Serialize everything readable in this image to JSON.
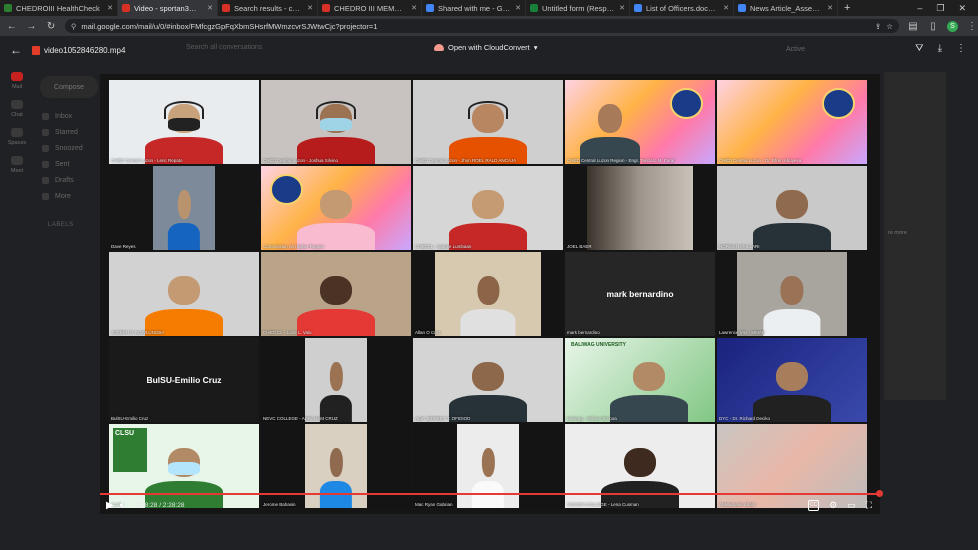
{
  "tabs": [
    {
      "title": "CHEDROIII HealthCheck",
      "color": "#2e7d32"
    },
    {
      "title": "Video - sportan3@ched.g",
      "color": "#d93025"
    },
    {
      "title": "Search results - chedro3c",
      "color": "#d93025"
    },
    {
      "title": "CHEDRO III MEMORAND",
      "color": "#d93025"
    },
    {
      "title": "Shared with me - Google",
      "color": "#4285f4"
    },
    {
      "title": "Untitled form (Responses",
      "color": "#188038"
    },
    {
      "title": "List of Officers.docx - Go",
      "color": "#4285f4"
    },
    {
      "title": "News Article_Assembly.d",
      "color": "#4285f4"
    }
  ],
  "active_tab": 1,
  "url": "mail.google.com/mail/u/0/#inbox/FMfcgzGpFqXbmSHsrfMWmzcvrSJWtwCjc?projector=1",
  "profile_initial": "S",
  "gmail": {
    "sidebar": [
      "Mail",
      "Chat",
      "Spaces",
      "Meet"
    ],
    "compose": "Compose",
    "menu": [
      "Inbox",
      "Starred",
      "Snoozed",
      "Sent",
      "Drafts",
      "More"
    ],
    "labels": "LABELS",
    "search_placeholder": "Search all conversations",
    "status": "Active",
    "panel_text": "re more"
  },
  "viewer": {
    "file_name": "video1052846280.mp4",
    "open_with": "Open with CloudConvert"
  },
  "participants": [
    "CHED Central Luzon - Lenc Repato",
    "CHED Central Luzon - Joshua Silvino",
    "CHED Central Luzon - Jhon ROEL RALD ANCAJA",
    "CHED Central Luzon Region - Engr. Teddoro M. Faral",
    "CHED Central Luzon - Dr. Efren Abuyeva",
    "Dave Reyes",
    "Commission on Higher Region",
    "CHEDCL - Katrice Lumbaan",
    "JOEL BAER",
    "NORMAN MALLARI",
    "JOSEPH P. ALIWLUNGBA",
    "CHED CL - Lorie L. Valo",
    "Allan O Cruz",
    "mark bernardino",
    "Lawrence Vito - MMAP",
    "BulSU-Emilio Cruz",
    "NEVC COLLEGE - ABRAHAM CRUZ",
    "ALIF JEFFREY T. OFIDIOD",
    "Baliwag - William Emboa",
    "DYC - Dr. Richard Deciko",
    "CLSU",
    "Jerome Bahasin",
    "Mac Ryan Gabrian",
    "VICSON COLLEGE - Lena Cusman",
    "Abellamarie Abalo"
  ],
  "tile_labels": {
    "mark_bernardino": "mark bernardino",
    "bulsu": "BulSU-Emilio Cruz",
    "clsu_logo": "CLSU",
    "baliwag_logo": "BALIWAG UNIVERSITY"
  },
  "player": {
    "time": "2:28:28 / 2:28:28",
    "progress_fraction": 1.0
  },
  "colors": {
    "progress": "#e53935",
    "browser_bg": "#1f1f1f",
    "toolbar_bg": "#35363a"
  },
  "icons": [
    "back-arrow-icon",
    "forward-arrow-icon",
    "reload-icon",
    "site-info-icon",
    "star-icon",
    "play-icon",
    "volume-icon",
    "captions-icon",
    "settings-icon",
    "miniplayer-icon",
    "fullscreen-icon",
    "add-to-drive-icon",
    "download-icon",
    "more-icon"
  ]
}
